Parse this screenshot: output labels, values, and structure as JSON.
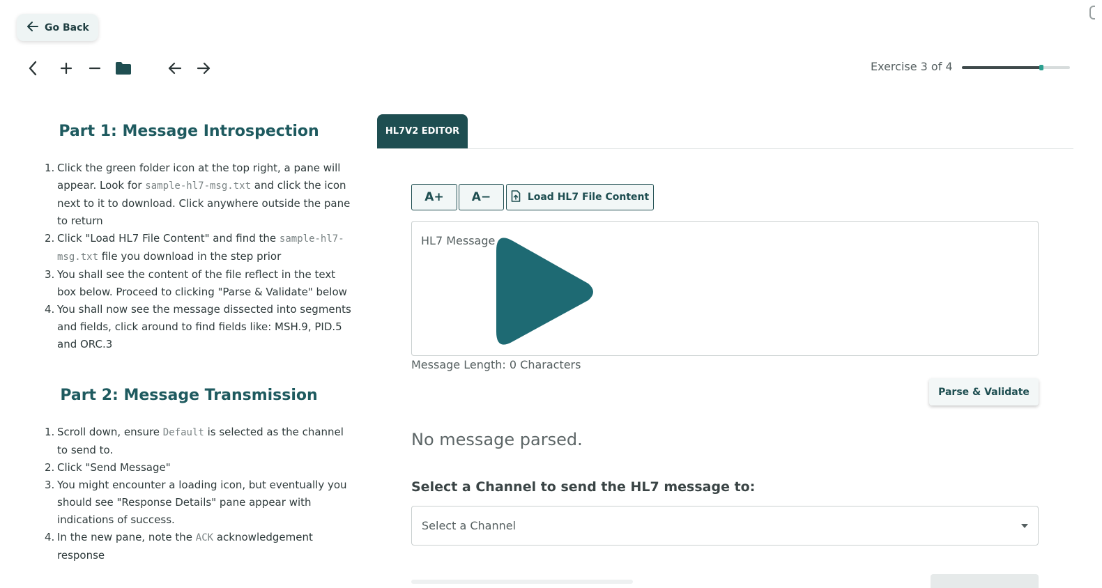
{
  "nav": {
    "go_back_label": "Go Back",
    "toolbar_icons": [
      "chevron-left-icon",
      "plus-icon",
      "minus-icon",
      "folder-icon",
      "arrow-left-icon",
      "arrow-right-icon"
    ]
  },
  "exercise": {
    "label": "Exercise 3 of 4",
    "progress_fraction": 0.75
  },
  "instructions": {
    "part1": {
      "title": "Part 1: Message Introspection",
      "steps": [
        {
          "a": "Click the green folder icon at the top right, a pane will appear. Look for ",
          "code": "sample-hl7-msg.txt",
          "b": " and click the icon next to it to download. Click anywhere outside the pane to return"
        },
        {
          "a": "Click \"Load HL7 File Content\" and find the ",
          "code": "sample-hl7-msg.txt",
          "b": " file you download in the step prior"
        },
        {
          "a": "You shall see the content of the file reflect in the text box below. Proceed to clicking \"Parse & Validate\" below",
          "code": "",
          "b": ""
        },
        {
          "a": "You shall now see the message dissected into segments and fields, click around to find fields like: MSH.9, PID.5 and ORC.3",
          "code": "",
          "b": ""
        }
      ]
    },
    "part2": {
      "title": "Part 2: Message Transmission",
      "steps": [
        {
          "a": "Scroll down, ensure ",
          "code": "Default",
          "b": " is selected as the channel to send to."
        },
        {
          "a": "Click \"Send Message\"",
          "code": "",
          "b": ""
        },
        {
          "a": "You might encounter a loading icon, but eventually you should see \"Response Details\" pane appear with indications of success.",
          "code": "",
          "b": ""
        },
        {
          "a": "In the new pane, note the ",
          "code": "ACK",
          "b": " acknowledgement response"
        }
      ]
    }
  },
  "editor": {
    "tab_label": "HL7V2 EDITOR",
    "font_increase_label": "A+",
    "font_decrease_label": "A−",
    "load_file_label": "Load HL7 File Content",
    "message_placeholder": "HL7 Message",
    "message_length": "Message Length: 0 Characters",
    "parse_label": "Parse & Validate",
    "no_message_text": "No message parsed."
  },
  "channel": {
    "heading": "Select a Channel to send the HL7 message to:",
    "placeholder": "Select a Channel"
  },
  "colors": {
    "brand_dark": "#1e4e51",
    "play_overlay": "#1e6a73",
    "accent_green": "#2a9f8f"
  }
}
